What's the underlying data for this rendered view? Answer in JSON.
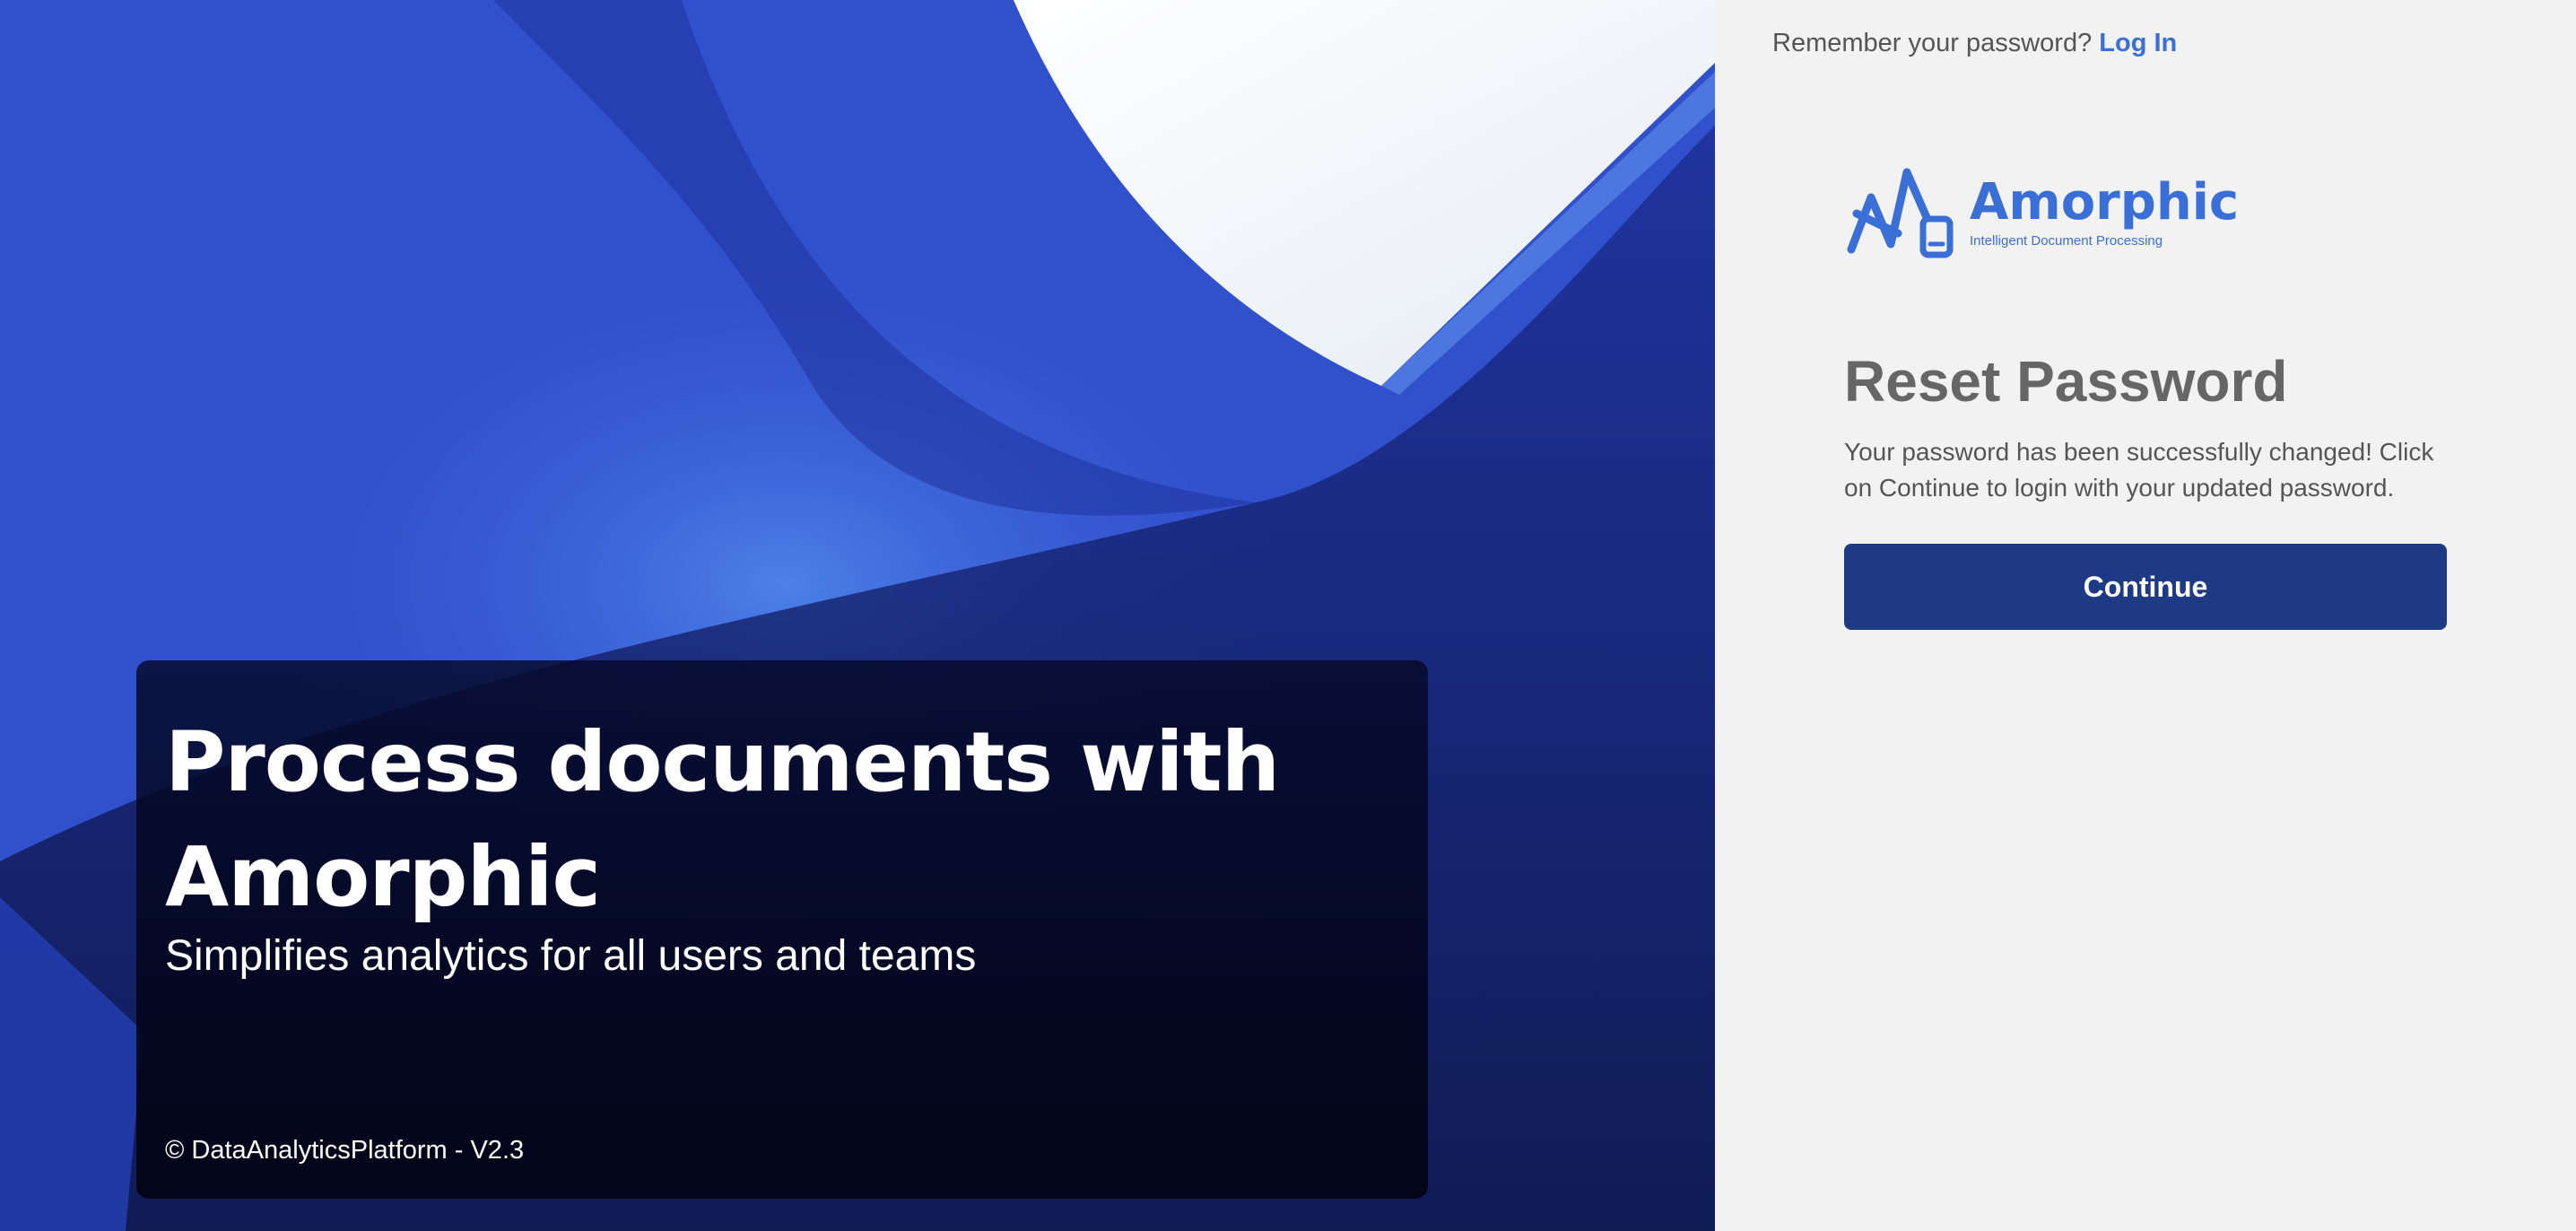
{
  "hero": {
    "title": "Process documents with Amorphic",
    "subtitle": "Simplifies analytics for all users and teams",
    "footer": "© DataAnalyticsPlatform - V2.3"
  },
  "panel": {
    "login_prompt": "Remember your password?",
    "login_link": "Log In",
    "logo": {
      "name": "Amorphic",
      "tagline": "Intelligent Document Processing",
      "icon": "amorphic-logo-icon"
    },
    "title": "Reset Password",
    "message": "Your password has been successfully changed! Click on Continue to login with your updated password.",
    "continue_label": "Continue"
  },
  "colors": {
    "accent": "#3a6fd8",
    "button": "#1f3a85",
    "hero_blue": "#3c5fd8",
    "panel_bg": "#f2f2f2"
  }
}
